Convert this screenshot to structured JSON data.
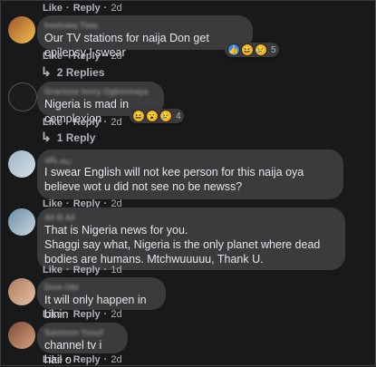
{
  "actions": {
    "like": "Like",
    "reply": "Reply",
    "dot": "·"
  },
  "comments": [
    {
      "time": "2d"
    },
    {
      "author": "Ireoluwa Tiwa",
      "text": "Our TV stations for naija Don get epilepsy I swear",
      "reactions": [
        "like",
        "haha",
        "sad"
      ],
      "reaction_count": "5",
      "time": "2d",
      "replies": "2 Replies"
    },
    {
      "author": "Graciose Ivory Ogbonnaya",
      "text": "Nigeria is mad in complexion",
      "reactions": [
        "haha",
        "wow",
        "sad"
      ],
      "reaction_count": "4",
      "time": "2d",
      "replies": "1 Reply"
    },
    {
      "author": "ريم باقة",
      "text": "I swear English will not kee person for this naija oya believe wot u did not see no be newss?",
      "time": "2d"
    },
    {
      "author": "Ali B Ali",
      "text": "That is Nigeria news for you.\nShaggi say what, Nigeria is the only planet where dead bodies are humans. Mtchwuuuuu, Thank U.",
      "time": "1d"
    },
    {
      "author": "Dom Obi",
      "text": "It will only happen in binin",
      "time": "2d"
    },
    {
      "author": "Salomon Yusuf",
      "text": "channel tv i hail o",
      "time": "2d"
    }
  ]
}
